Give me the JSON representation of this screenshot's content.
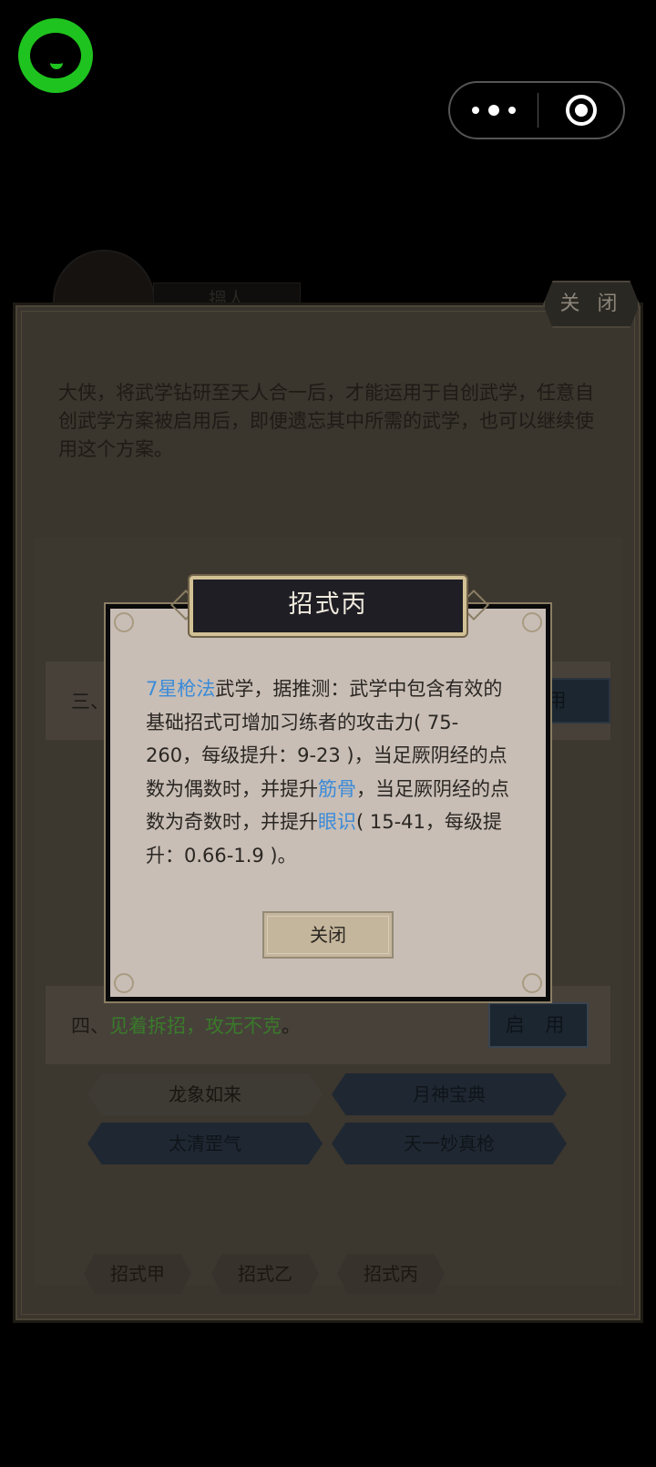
{
  "top_bar": {
    "logo_icon": "chat-bubble-logo-icon",
    "more_icon": "more-dots-icon",
    "target_icon": "target-circle-icon"
  },
  "panel": {
    "close_label": "关 闭",
    "intro_text": "大侠，将武学钻研至天人合一后，才能运用于自创武学，任意自创武学方案被启用后，即便遗忘其中所需的武学，也可以继续使用这个方案。",
    "bg_name": "搵人"
  },
  "scheme_rows": [
    {
      "label": "三、",
      "enable_label": "用"
    },
    {
      "label_prefix": "四、",
      "label_highlight": "见着拆招，攻无不克",
      "label_suffix": "。",
      "enable_label": "启 用"
    }
  ],
  "skills_row4": [
    {
      "name": "龙象如来",
      "style": "light"
    },
    {
      "name": "月神宝典",
      "style": "dark"
    },
    {
      "name": "太清罡气",
      "style": "dark"
    },
    {
      "name": "天一妙真枪",
      "style": "dark"
    }
  ],
  "tabs": [
    "招式甲",
    "招式乙",
    "招式丙"
  ],
  "dialog": {
    "title": "招式丙",
    "body": {
      "hl1": "7星枪法",
      "t1": "武学，据推测：武学中包含有效的基础招式可增加习练者的攻击力( 75-260，每级提升：9-23 )，当足厥阴经的点数为偶数时，并提升",
      "hl2": "筋骨",
      "t2": "，当足厥阴经的点数为奇数时，并提升",
      "hl3": "眼识",
      "t3": "( 15-41，每级提升：0.66-1.9 )。"
    },
    "close_label": "关闭"
  },
  "colors": {
    "highlight_blue": "#3b8bd9",
    "highlight_green": "#3a7a2a",
    "logo_green": "#1fc31f"
  }
}
